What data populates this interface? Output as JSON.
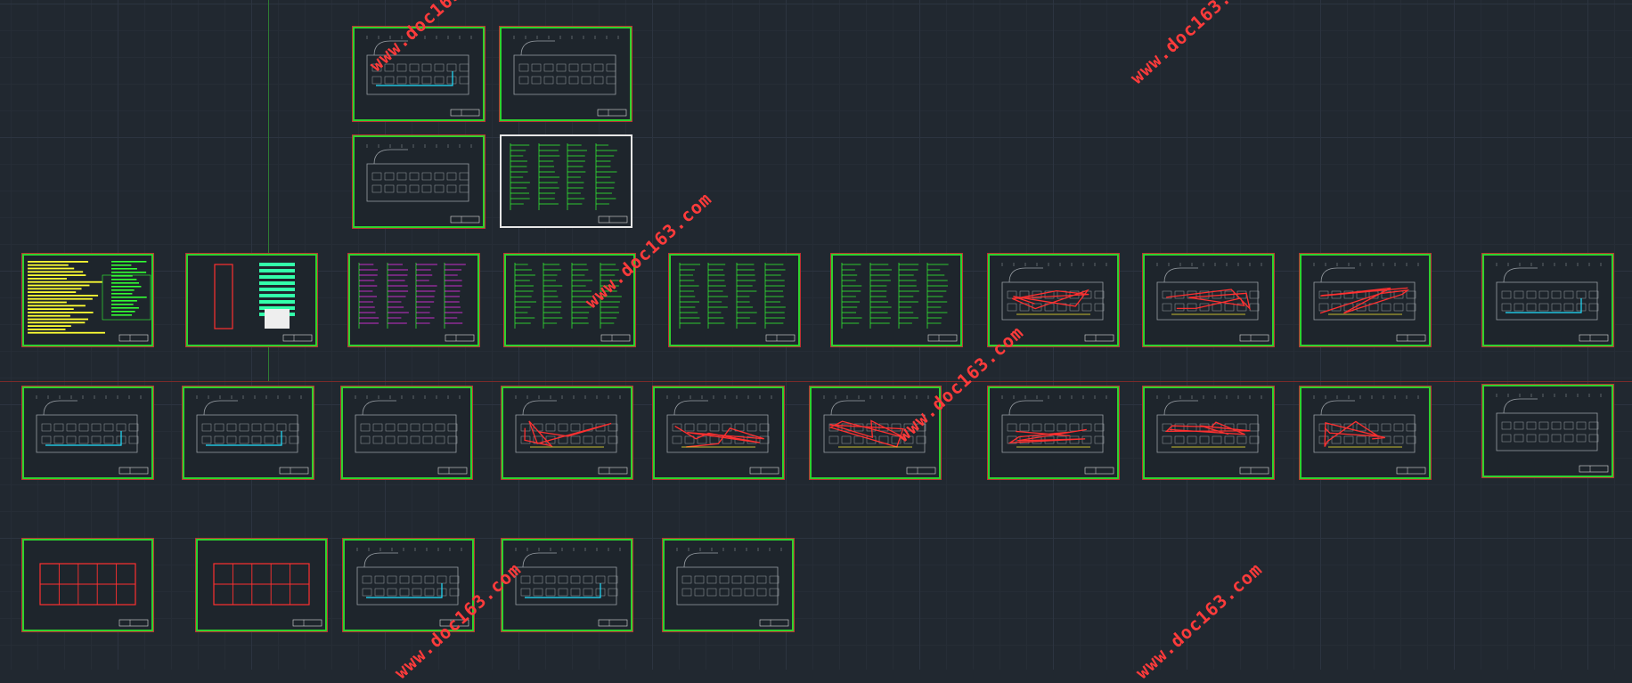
{
  "viewport": {
    "background": "#212830",
    "sheet_border_color": "#2fd12f",
    "sheet_outline_color": "#bb3333"
  },
  "watermark": {
    "text": "www.doc163.com",
    "color": "#ff3b3b"
  },
  "drawing_sheets": [
    {
      "id": "sheet-floor-plan-a",
      "variant": "plan-cyan"
    },
    {
      "id": "sheet-floor-plan-b",
      "variant": "plan"
    },
    {
      "id": "sheet-floor-plan-c",
      "variant": "plan"
    },
    {
      "id": "sheet-system-diagram-white",
      "variant": "schematic"
    },
    {
      "id": "sheet-notes-yellow",
      "variant": "notes"
    },
    {
      "id": "sheet-riser-diagram",
      "variant": "riser"
    },
    {
      "id": "sheet-magenta-schedule",
      "variant": "schedule"
    },
    {
      "id": "sheet-schematic-a",
      "variant": "schematic"
    },
    {
      "id": "sheet-schematic-b",
      "variant": "schematic"
    },
    {
      "id": "sheet-schematic-c",
      "variant": "schematic"
    },
    {
      "id": "sheet-plan-red-a",
      "variant": "plan-red"
    },
    {
      "id": "sheet-plan-red-b",
      "variant": "plan-red"
    },
    {
      "id": "sheet-plan-red-c",
      "variant": "plan-red"
    },
    {
      "id": "sheet-plan-cyan-right",
      "variant": "plan-cyan"
    },
    {
      "id": "sheet-row2-1",
      "variant": "plan-cyan"
    },
    {
      "id": "sheet-row2-2",
      "variant": "plan-cyan"
    },
    {
      "id": "sheet-row2-3",
      "variant": "outline"
    },
    {
      "id": "sheet-row2-4",
      "variant": "plan-red"
    },
    {
      "id": "sheet-row2-5",
      "variant": "plan-red"
    },
    {
      "id": "sheet-row2-6",
      "variant": "plan-red"
    },
    {
      "id": "sheet-row2-7",
      "variant": "plan-red"
    },
    {
      "id": "sheet-row2-8",
      "variant": "plan-red"
    },
    {
      "id": "sheet-row2-9",
      "variant": "plan-red"
    },
    {
      "id": "sheet-row2-10",
      "variant": "outline"
    },
    {
      "id": "sheet-row3-1",
      "variant": "grid-red"
    },
    {
      "id": "sheet-row3-2",
      "variant": "grid-red"
    },
    {
      "id": "sheet-row3-3",
      "variant": "plan-cyan"
    },
    {
      "id": "sheet-row3-4",
      "variant": "plan-cyan"
    },
    {
      "id": "sheet-row3-5",
      "variant": "plan"
    }
  ]
}
